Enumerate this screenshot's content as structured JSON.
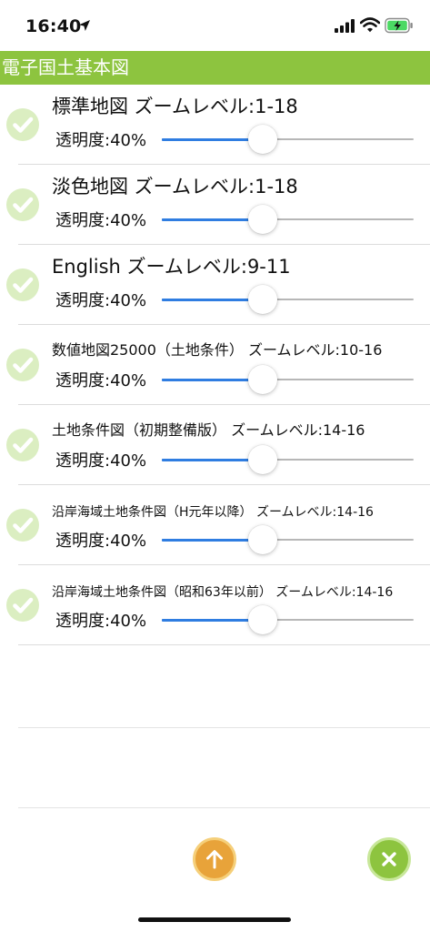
{
  "status_bar": {
    "time": "16:40",
    "icons": [
      "location-arrow-icon",
      "cellular-signal-icon",
      "wifi-icon",
      "battery-charging-icon"
    ]
  },
  "header": {
    "title": "電子国土基本図"
  },
  "colors": {
    "header_bg": "#8dc43f",
    "slider_active": "#2f7de1",
    "check_icon": "#dbeec1",
    "up_button": "#e8a33a",
    "close_button": "#8dc43f"
  },
  "layers": [
    {
      "title": "標準地図 ズームレベル:1-18",
      "opacity_label": "透明度:40%",
      "opacity": 0.4,
      "checked": true
    },
    {
      "title": "淡色地図 ズームレベル:1-18",
      "opacity_label": "透明度:40%",
      "opacity": 0.4,
      "checked": true
    },
    {
      "title": "English ズームレベル:9-11",
      "opacity_label": "透明度:40%",
      "opacity": 0.4,
      "checked": true
    },
    {
      "title": "数値地図25000（土地条件） ズームレベル:10-16",
      "opacity_label": "透明度:40%",
      "opacity": 0.4,
      "checked": true
    },
    {
      "title": "土地条件図（初期整備版） ズームレベル:14-16",
      "opacity_label": "透明度:40%",
      "opacity": 0.4,
      "checked": true
    },
    {
      "title": "沿岸海域土地条件図（H元年以降） ズームレベル:14-16",
      "opacity_label": "透明度:40%",
      "opacity": 0.4,
      "checked": true
    },
    {
      "title": "沿岸海域土地条件図（昭和63年以前） ズームレベル:14-16",
      "opacity_label": "透明度:40%",
      "opacity": 0.4,
      "checked": true
    }
  ],
  "buttons": {
    "up": {
      "icon": "arrow-up-icon"
    },
    "close": {
      "icon": "close-icon"
    }
  }
}
